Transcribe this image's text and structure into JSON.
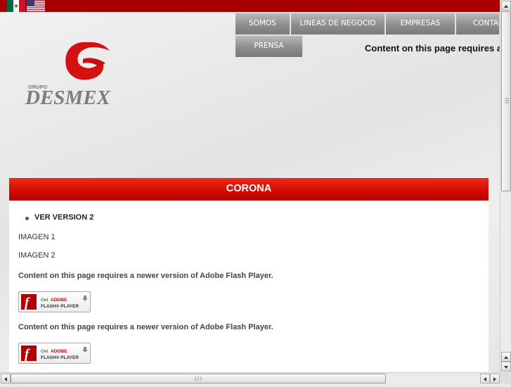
{
  "nav": {
    "somos": "SOMOS",
    "lineas": "LINEAS DE NEGOCIO",
    "empresas": "EMPRESAS",
    "contacto": "CONTAC",
    "prensa": "PRENSA"
  },
  "logo": {
    "small": "GRUPO",
    "name": "DESMEX"
  },
  "top_flash_message": "Content on this page requires a",
  "panel": {
    "title": "CORONA",
    "bullet": "VER VERSION 2",
    "image1": "IMAGEN 1",
    "image2": "IMAGEN 2",
    "flash_message": "Content on this page requires a newer version of Adobe Flash Player.",
    "flash_badge": {
      "get": "Get",
      "adobe": "ADOBE",
      "flash_player": "FLASH® PLAYER"
    }
  },
  "colors": {
    "accent_red": "#d00b00",
    "topbar": "#a80000"
  }
}
